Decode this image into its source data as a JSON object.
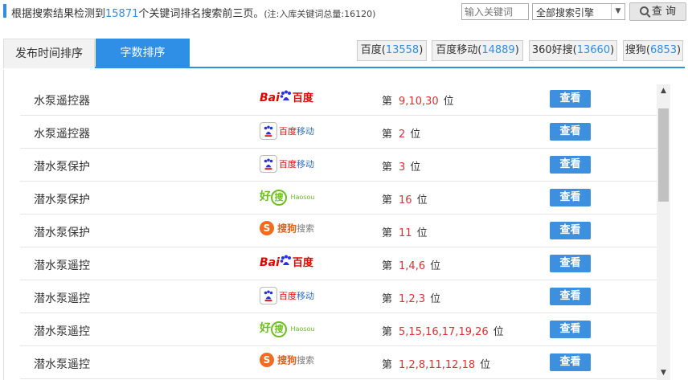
{
  "summary": {
    "prefix": "根据搜索结果检测到",
    "count": "15871",
    "suffix": "个关键词排名搜索前三页。",
    "note": "(注:入库关键词总量:16120)"
  },
  "search": {
    "placeholder": "输入关键词",
    "engine_selected": "全部搜索引擎",
    "query_label": "查 询"
  },
  "tabs": [
    {
      "label": "发布时间排序",
      "active": false
    },
    {
      "label": "字数排序",
      "active": true
    }
  ],
  "engine_tabs": [
    {
      "name": "百度",
      "count": "13558"
    },
    {
      "name": "百度移动",
      "count": "14889"
    },
    {
      "name": "360好搜",
      "count": "13660"
    },
    {
      "name": "搜狗",
      "count": "6853"
    }
  ],
  "rank_prefix": "第",
  "rank_suffix": "位",
  "view_label": "查看",
  "logos": {
    "baidu": {
      "a": "Bai",
      "b": "百度"
    },
    "baidu_mobile": {
      "a": "百度",
      "b": "移动"
    },
    "haosou": {
      "a": "好",
      "b": "搜",
      "c": "Haosou"
    },
    "sogou": {
      "a": "S",
      "b": "搜狗",
      "c": "搜索"
    }
  },
  "rows": [
    {
      "keyword": "水泵遥控器",
      "engine": "baidu",
      "positions": "9,10,30"
    },
    {
      "keyword": "水泵遥控器",
      "engine": "baidu_mobile",
      "positions": "2"
    },
    {
      "keyword": "潜水泵保护",
      "engine": "baidu_mobile",
      "positions": "3"
    },
    {
      "keyword": "潜水泵保护",
      "engine": "haosou",
      "positions": "16"
    },
    {
      "keyword": "潜水泵保护",
      "engine": "sogou",
      "positions": "11"
    },
    {
      "keyword": "潜水泵遥控",
      "engine": "baidu",
      "positions": "1,4,6"
    },
    {
      "keyword": "潜水泵遥控",
      "engine": "baidu_mobile",
      "positions": "1,2,3"
    },
    {
      "keyword": "潜水泵遥控",
      "engine": "haosou",
      "positions": "5,15,16,17,19,26"
    },
    {
      "keyword": "潜水泵遥控",
      "engine": "sogou",
      "positions": "1,2,8,11,12,18"
    }
  ],
  "colors": {
    "accent": "#2f8ee6",
    "rank": "#e03030",
    "button": "#3d8fe0"
  }
}
